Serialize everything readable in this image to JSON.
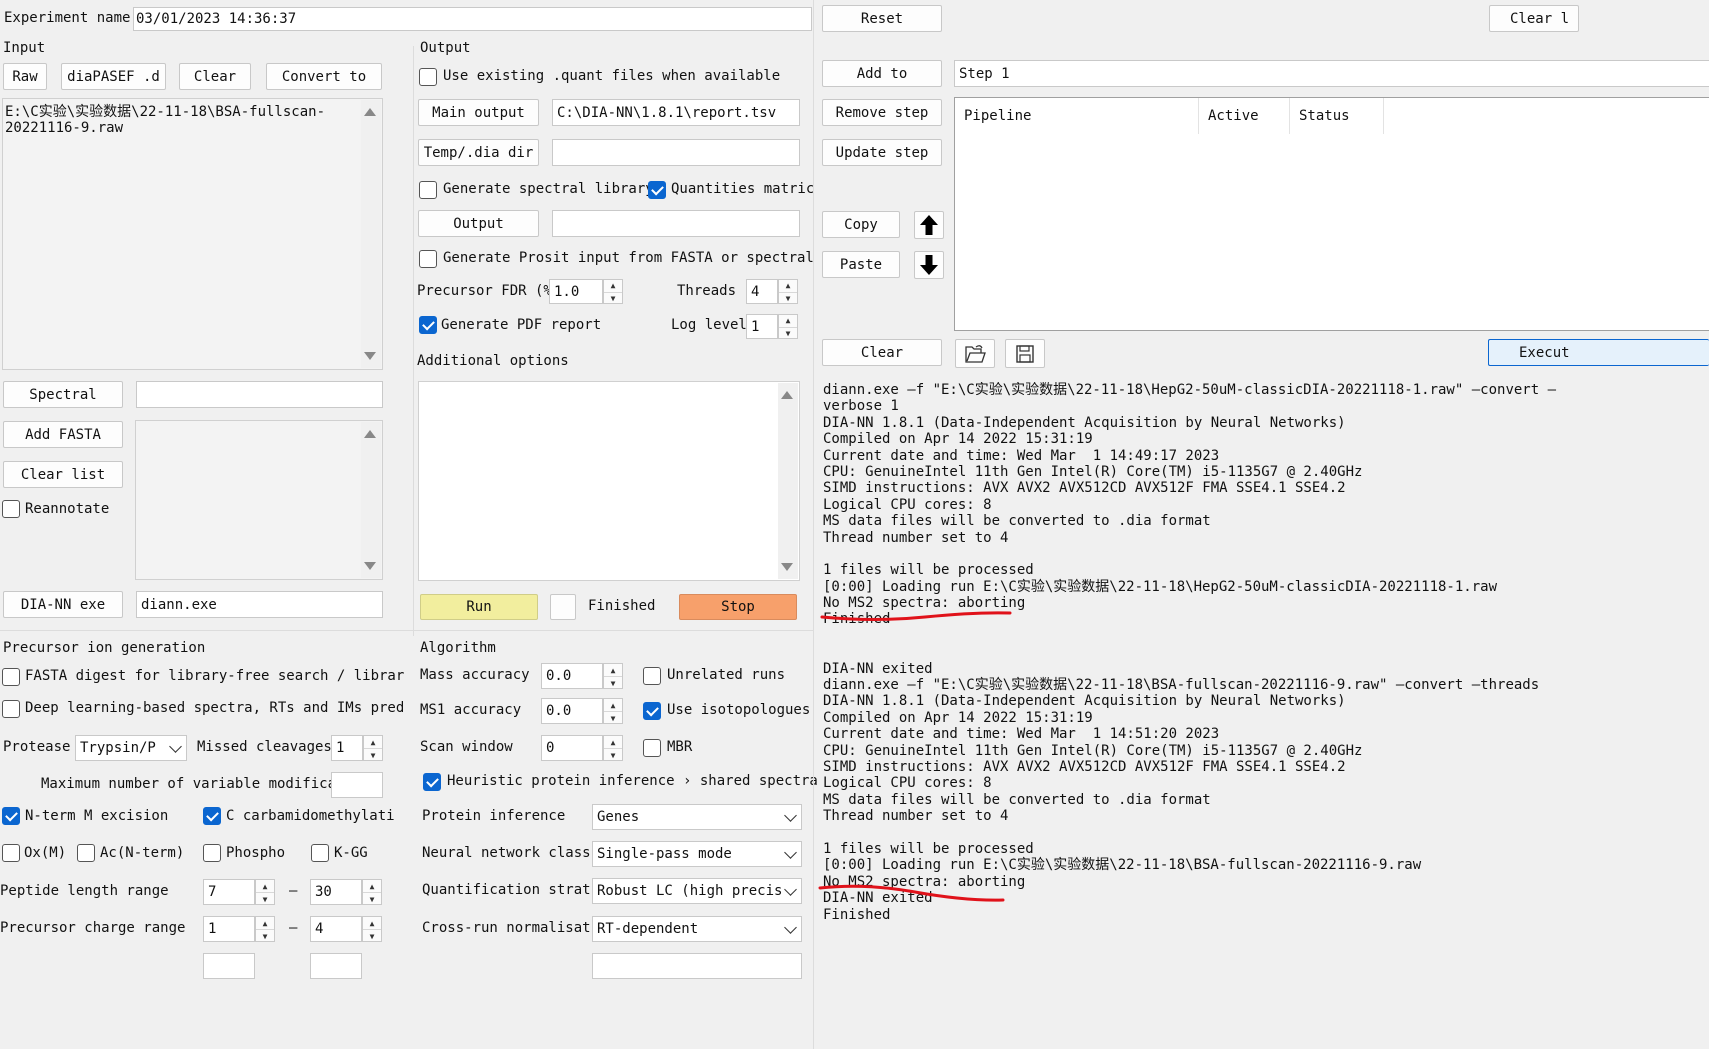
{
  "experiment": {
    "label": "Experiment name:",
    "value": "03/01/2023 14:36:37"
  },
  "input": {
    "title": "Input",
    "raw_btn": "Raw",
    "diapasef_btn": "diaPASEF .d",
    "clear_btn": "Clear",
    "convert_btn": "Convert to",
    "files_text": "E:\\C实验\\实验数据\\22-11-18\\BSA-fullscan-\n20221116-9.raw",
    "spectral_btn": "Spectral",
    "spectral_value": "",
    "add_fasta_btn": "Add FASTA",
    "clear_list_btn": "Clear list",
    "reannotate_label": "Reannotate",
    "diann_exe_btn": "DIA-NN exe",
    "diann_exe_value": "diann.exe"
  },
  "output": {
    "title": "Output",
    "use_existing_label": "Use existing .quant files when available",
    "main_output_btn": "Main output",
    "main_output_value": "C:\\DIA-NN\\1.8.1\\report.tsv",
    "temp_dir_btn": "Temp/.dia dir",
    "temp_dir_value": "",
    "gen_spectral_label": "Generate spectral library",
    "quantities_label": "Quantities matric",
    "output_btn": "Output",
    "output_value": "",
    "prosit_label": "Generate Prosit input from FASTA or spectral",
    "fdr_label": "Precursor FDR (%",
    "fdr_value": "1.0",
    "threads_label": "Threads",
    "threads_value": "4",
    "pdf_label": "Generate PDF report",
    "loglevel_label": "Log level",
    "loglevel_value": "1",
    "additional_label": "Additional options",
    "run_btn": "Run",
    "finished_label": "Finished",
    "stop_btn": "Stop"
  },
  "pipeline": {
    "reset_btn": "Reset",
    "clear_log_btn": "Clear l",
    "add_to_btn": "Add to",
    "step_value": "Step 1",
    "remove_step_btn": "Remove step",
    "update_step_btn": "Update step",
    "copy_btn": "Copy",
    "paste_btn": "Paste",
    "clear_btn": "Clear",
    "execute_btn": "Execut",
    "columns": [
      "Pipeline",
      "Active",
      "Status"
    ]
  },
  "precursor": {
    "title": "Precursor ion generation",
    "fasta_digest_label": "FASTA digest for library-free search / librar",
    "deep_learning_label": "Deep learning-based spectra, RTs and IMs pred",
    "protease_label": "Protease",
    "protease_value": "Trypsin/P",
    "missed_label": "Missed cleavages",
    "missed_value": "1",
    "maxmod_label": "Maximum number of variable modifications",
    "nterm_label": "N-term M excision",
    "ccarb_label": "C carbamidomethylati",
    "ox_label": "Ox(M)",
    "ac_label": "Ac(N-term)",
    "phospho_label": "Phospho",
    "kgg_label": "K-GG",
    "peplen_label": "Peptide length range",
    "peplen_min": "7",
    "peplen_max": "30",
    "charge_label": "Precursor charge range",
    "charge_min": "1",
    "charge_max": "4",
    "dash": "–"
  },
  "algorithm": {
    "title": "Algorithm",
    "mass_acc_label": "Mass accuracy",
    "mass_acc_value": "0.0",
    "unrelated_label": "Unrelated runs",
    "ms1_acc_label": "MS1 accuracy",
    "ms1_acc_value": "0.0",
    "isotop_label": "Use isotopologues",
    "scan_label": "Scan window",
    "scan_value": "0",
    "mbr_label": "MBR",
    "heuristic_label": "Heuristic protein inference › shared spectra",
    "protinf_label": "Protein inference",
    "protinf_value": "Genes",
    "nn_label": "Neural network class",
    "nn_value": "Single-pass mode",
    "quant_label": "Quantification strat",
    "quant_value": "Robust LC (high precis",
    "norm_label": "Cross-run normalisat",
    "norm_value": "RT-dependent"
  },
  "log_lines": [
    "diann.exe —f \"E:\\C实验\\实验数据\\22-11-18\\HepG2-50uM-classicDIA-20221118-1.raw\" —convert —",
    "verbose 1",
    "DIA-NN 1.8.1 (Data-Independent Acquisition by Neural Networks)",
    "Compiled on Apr 14 2022 15:31:19",
    "Current date and time: Wed Mar  1 14:49:17 2023",
    "CPU: GenuineIntel 11th Gen Intel(R) Core(TM) i5-1135G7 @ 2.40GHz",
    "SIMD instructions: AVX AVX2 AVX512CD AVX512F FMA SSE4.1 SSE4.2",
    "Logical CPU cores: 8",
    "MS data files will be converted to .dia format",
    "Thread number set to 4",
    "",
    "1 files will be processed",
    "[0:00] Loading run E:\\C实验\\实验数据\\22-11-18\\HepG2-50uM-classicDIA-20221118-1.raw",
    "No MS2 spectra: aborting",
    "Finished",
    "",
    "",
    "DIA-NN exited",
    "diann.exe —f \"E:\\C实验\\实验数据\\22-11-18\\BSA-fullscan-20221116-9.raw\" —convert —threads",
    "DIA-NN 1.8.1 (Data-Independent Acquisition by Neural Networks)",
    "Compiled on Apr 14 2022 15:31:19",
    "Current date and time: Wed Mar  1 14:51:20 2023",
    "CPU: GenuineIntel 11th Gen Intel(R) Core(TM) i5-1135G7 @ 2.40GHz",
    "SIMD instructions: AVX AVX2 AVX512CD AVX512F FMA SSE4.1 SSE4.2",
    "Logical CPU cores: 8",
    "MS data files will be converted to .dia format",
    "Thread number set to 4",
    "",
    "1 files will be processed",
    "[0:00] Loading run E:\\C实验\\实验数据\\22-11-18\\BSA-fullscan-20221116-9.raw",
    "No MS2 spectra: aborting",
    "DIA-NN exited",
    "Finished"
  ],
  "colors": {
    "run": "#f2ee9e",
    "stop": "#f7a06b",
    "accent": "#0b66d0",
    "annotation": "#e0121a"
  }
}
